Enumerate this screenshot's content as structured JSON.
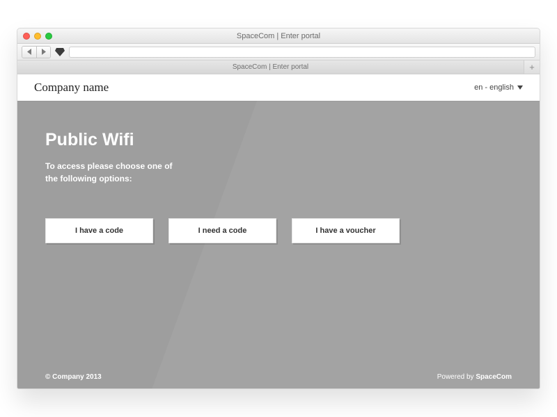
{
  "window": {
    "title": "SpaceCom | Enter portal",
    "tab_label": "SpaceCom | Enter portal"
  },
  "header": {
    "company_name": "Company name",
    "language_label": "en - english"
  },
  "main": {
    "heading": "Public Wifi",
    "instructions": "To access please choose one of the following options:",
    "options": [
      {
        "label": "I have a code"
      },
      {
        "label": "I need a code"
      },
      {
        "label": "I have a voucher"
      }
    ]
  },
  "footer": {
    "copyright": "© Company 2013",
    "powered_prefix": "Powered by ",
    "powered_brand": "SpaceCom"
  }
}
